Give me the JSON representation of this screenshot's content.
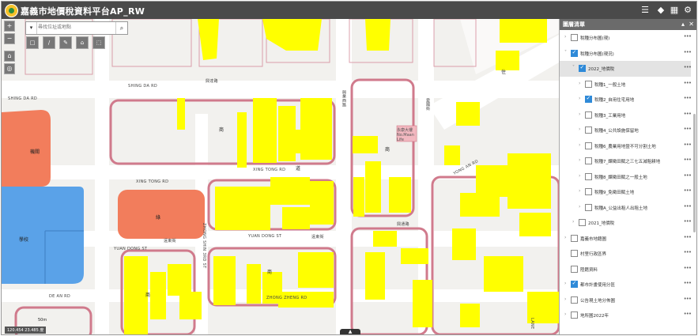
{
  "app": {
    "title": "嘉義市地價稅資料平台AP_RW"
  },
  "toolbar_icons": [
    {
      "name": "list-view-icon",
      "glyph": "☰"
    },
    {
      "name": "layers-icon",
      "glyph": "◆"
    },
    {
      "name": "basemap-gallery-icon",
      "glyph": "▦"
    },
    {
      "name": "settings-icon",
      "glyph": "⚙"
    }
  ],
  "map_tools": {
    "zoom_in": "+",
    "zoom_out": "−",
    "home": "⌂",
    "locate": "◎"
  },
  "search": {
    "placeholder": "尋找位址或地點",
    "dropdown": "▾",
    "search_icon": "⌕"
  },
  "draw_tools": [
    "□",
    "/",
    "✎",
    "⌂",
    "⬚"
  ],
  "roads": {
    "shing_da": "SHING DA RD",
    "shing_da_cn": "興達路",
    "xing_tong": "XING TONG RD",
    "xing_tong_cn": "興通路",
    "yuan_dong": "YUAN DONG ST",
    "yuan_dong_cn": "遠東街",
    "de_an": "DE AN RD",
    "zhong_shin_3rd": "ZHONG SHIN 3RD ST",
    "yuan_dong_2": "YUAN DONG ST",
    "yuan_dong_cn2": "遠東街",
    "zhong_zheng": "ZHONG ZHENG RD",
    "lane": "LANE",
    "xiang": "興業西路",
    "ai_guo": "愛國街",
    "yong_an": "YONG AN RD"
  },
  "zone_labels": {
    "zhu": "住",
    "shang1": "商",
    "shang2": "商",
    "shang3": "商",
    "dao": "道",
    "special_1": "機關",
    "special_2": "學校",
    "special_3": "綠",
    "shang4": "商"
  },
  "map_building_label": "永康大樓 No.Maan Life",
  "scale": {
    "label": "50m"
  },
  "coords": {
    "text": "120.454 23.485 度"
  },
  "bottom_handle": {
    "glyph": "▲"
  },
  "panel": {
    "title": "圖層清單",
    "collapse_glyph": "▴",
    "close_glyph": "✕",
    "items": [
      {
        "label": "稅種分布圖(現)",
        "checked": false,
        "arrow": "›",
        "level": 1,
        "more": "•••"
      },
      {
        "label": "稅種分布圖(現況)",
        "checked": true,
        "arrow": "˅",
        "level": 1,
        "more": "•••"
      },
      {
        "label": "2022_地價稅",
        "checked": true,
        "arrow": "˅",
        "level": 2,
        "more": "•••"
      },
      {
        "label": "稅種1_一般土地",
        "checked": false,
        "arrow": "›",
        "level": 3,
        "more": "•••"
      },
      {
        "label": "稅種2_自用住宅用地",
        "checked": true,
        "arrow": "›",
        "level": 3,
        "more": "•••"
      },
      {
        "label": "稅種3_工業用地",
        "checked": false,
        "arrow": "›",
        "level": 3,
        "more": "•••"
      },
      {
        "label": "稅種4_公共設施保留地",
        "checked": false,
        "arrow": "›",
        "level": 3,
        "more": "•••"
      },
      {
        "label": "稅種6_農業用地暨不可分割土地",
        "checked": false,
        "arrow": "›",
        "level": 3,
        "more": "•••"
      },
      {
        "label": "稅種7_課徵田賦之三七五減租耕地",
        "checked": false,
        "arrow": "›",
        "level": 3,
        "more": "•••"
      },
      {
        "label": "稅種8_課徵田賦之一般土地",
        "checked": false,
        "arrow": "›",
        "level": 3,
        "more": "•••"
      },
      {
        "label": "稅種9_免徵田賦土地",
        "checked": false,
        "arrow": "›",
        "level": 3,
        "more": "•••"
      },
      {
        "label": "稅種A_公益出租人出租土地",
        "checked": false,
        "arrow": "›",
        "level": 3,
        "more": "•••"
      },
      {
        "label": "2021_地價稅",
        "checked": false,
        "arrow": "›",
        "level": 2,
        "more": "•••"
      },
      {
        "label": "嘉義市地籍圖",
        "checked": false,
        "arrow": "›",
        "level": 1,
        "more": "•••"
      },
      {
        "label": "村里行政區界",
        "checked": false,
        "arrow": "",
        "level": 1,
        "more": "•••"
      },
      {
        "label": "陸籍資料",
        "checked": false,
        "arrow": "",
        "level": 1,
        "more": "•••"
      },
      {
        "label": "都市計畫使用分區",
        "checked": true,
        "arrow": "›",
        "level": 1,
        "more": "•••"
      },
      {
        "label": "公告現土地分佈圖",
        "checked": false,
        "arrow": "›",
        "level": 1,
        "more": "•••"
      },
      {
        "label": "地所圖2022年",
        "checked": false,
        "arrow": "›",
        "level": 1,
        "more": "•••"
      }
    ]
  },
  "colors": {
    "topbar": "#4a4a4a",
    "parcel_yellow": "#ffff00",
    "block_border": "#d07a8c",
    "zone_orange": "#f27d5c",
    "zone_blue": "#5aa2e8",
    "checkbox_blue": "#2f8ad8"
  }
}
